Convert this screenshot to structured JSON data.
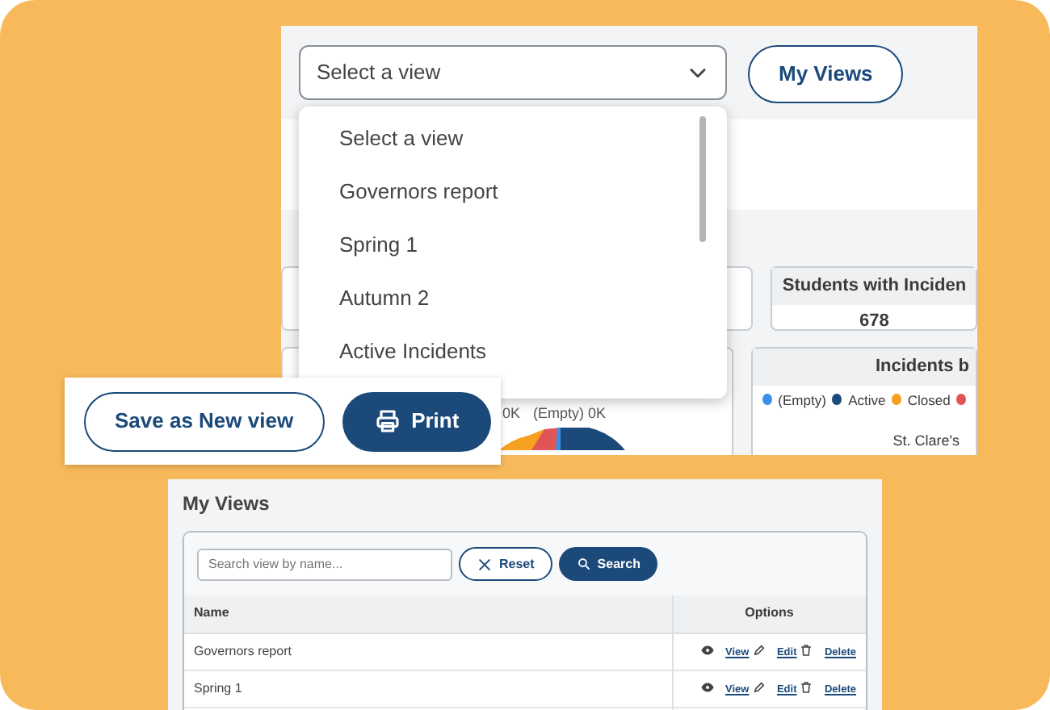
{
  "dashboard": {
    "view_select": {
      "value": "Select a view"
    },
    "my_views_button": "My Views",
    "view_options": [
      {
        "label": "Select a view"
      },
      {
        "label": "Governors report"
      },
      {
        "label": "Spring 1"
      },
      {
        "label": "Autumn 2"
      },
      {
        "label": "Active Incidents"
      }
    ],
    "stat_card": {
      "title": "Students with Inciden",
      "value": "678"
    },
    "pie_labels": [
      "0K",
      "(Empty) 0K"
    ],
    "incidents_chart": {
      "title": "Incidents b",
      "legend": [
        {
          "label": "(Empty)",
          "color": "#3b8fe8"
        },
        {
          "label": "Active",
          "color": "#1b4a7a"
        },
        {
          "label": "Closed",
          "color": "#f5a01e"
        },
        {
          "color": "#e05555"
        }
      ],
      "category": "St. Clare's"
    }
  },
  "save_panel": {
    "buttons": [
      {
        "label": "Save as New view",
        "kind": "outline"
      },
      {
        "label": "Print",
        "kind": "print"
      }
    ]
  },
  "my_views": {
    "title": "My Views",
    "search": {
      "placeholder": "Search view by name..."
    },
    "buttons": [
      {
        "label": "Reset",
        "kind": "reset"
      },
      {
        "label": "Search",
        "kind": "search"
      }
    ],
    "columns": [
      "Name",
      "Options"
    ],
    "rows": [
      {
        "name": "Governors report",
        "actions": [
          {
            "label": "View",
            "kind": "view"
          },
          {
            "label": "Edit",
            "kind": "edit"
          },
          {
            "label": "Delete",
            "kind": "delete"
          }
        ]
      },
      {
        "name": "Spring 1",
        "actions": [
          {
            "label": "View",
            "kind": "view"
          },
          {
            "label": "Edit",
            "kind": "edit"
          },
          {
            "label": "Delete",
            "kind": "delete"
          }
        ]
      }
    ]
  }
}
